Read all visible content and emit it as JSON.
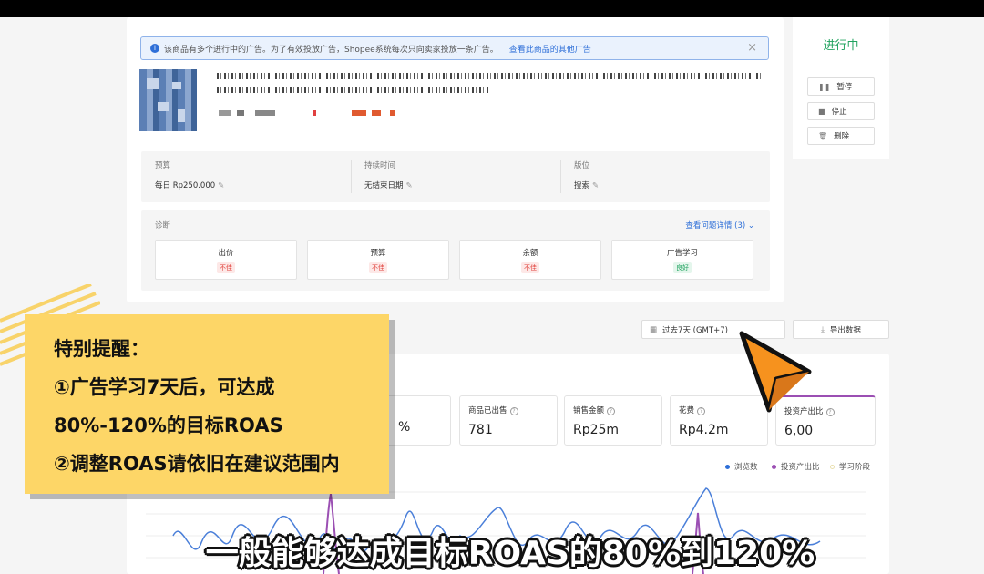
{
  "notice": {
    "text": "该商品有多个进行中的广告。为了有效投放广告，Shopee系统每次只向卖家投放一条广告。",
    "link": "查看此商品的其他广告"
  },
  "info": {
    "budget_label": "预算",
    "budget_value": "每日 Rp250.000",
    "duration_label": "持续时间",
    "duration_value": "无结束日期",
    "placement_label": "版位",
    "placement_value": "搜索"
  },
  "diagnosis": {
    "title": "诊断",
    "more": "查看问题详情 (3)",
    "items": [
      {
        "name": "出价",
        "status": "不佳"
      },
      {
        "name": "预算",
        "status": "不佳"
      },
      {
        "name": "余额",
        "status": "不佳"
      },
      {
        "name": "广告学习",
        "status": "良好"
      }
    ]
  },
  "side": {
    "status": "进行中",
    "pause": "暂停",
    "stop": "停止",
    "delete": "删除"
  },
  "toolbar": {
    "date_range": "过去7天 (GMT+7)",
    "export": "导出数据"
  },
  "metrics": [
    {
      "label": "",
      "value": "%"
    },
    {
      "label": "商品已出售",
      "value": "781"
    },
    {
      "label": "销售金额",
      "value": "Rp25m"
    },
    {
      "label": "花费",
      "value": "Rp4.2m"
    },
    {
      "label": "投资产出比",
      "value": "6,00"
    }
  ],
  "legend": [
    {
      "label": "浏览数",
      "color": "#2e6fd8"
    },
    {
      "label": "投资产出比",
      "color": "#9b4fb3"
    },
    {
      "label": "学习阶段",
      "color": "#f3ebc6"
    }
  ],
  "callout": {
    "line1": "特别提醒：",
    "line2": "①广告学习7天后，可达成",
    "line3": "80%-120%的目标ROAS",
    "line4": "②调整ROAS请依旧在建议范围内"
  },
  "caption": "一般能够达成目标ROAS的80%到120%",
  "colors": {
    "accent_blue": "#2e6fd8",
    "status_green": "#21a35f",
    "callout_yellow": "#fdd667",
    "cursor_orange": "#f6921e"
  }
}
